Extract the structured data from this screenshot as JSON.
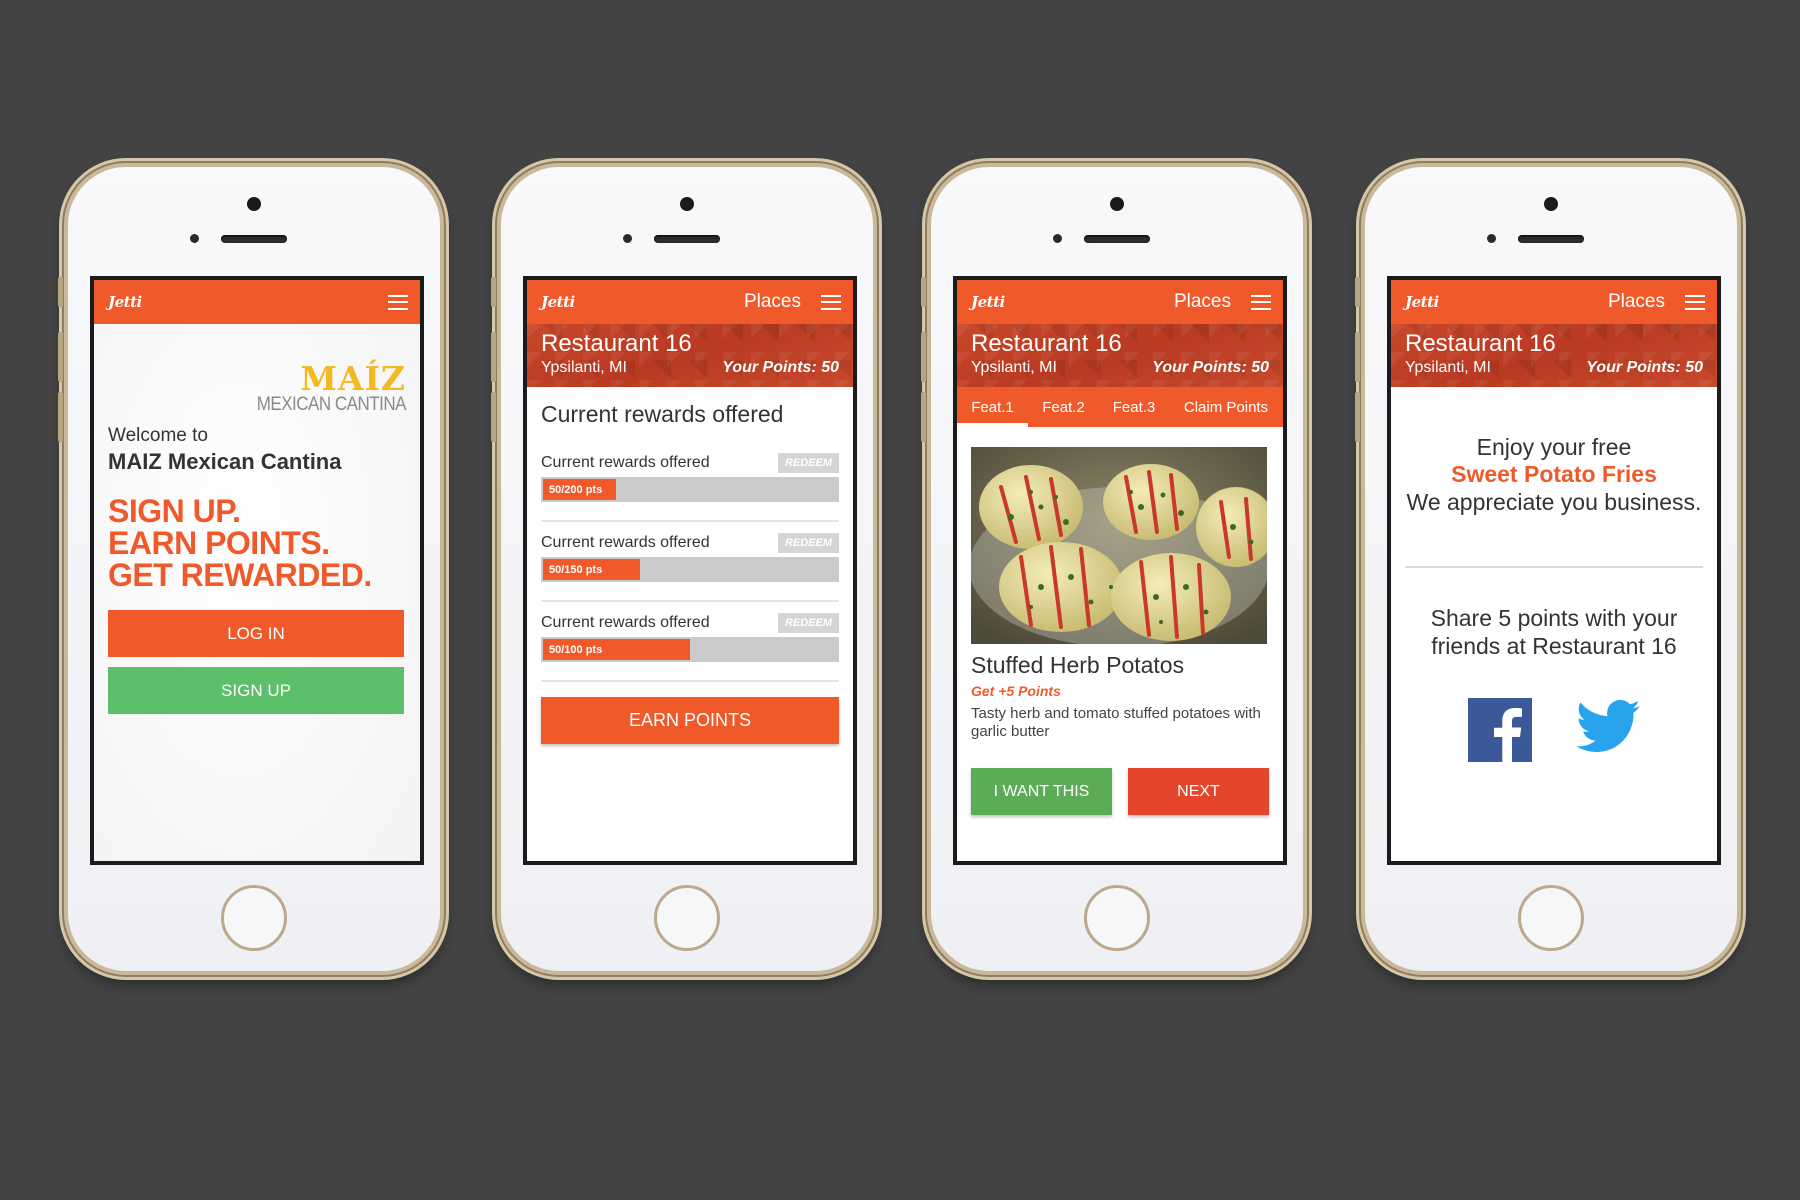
{
  "brand": {
    "logo": "Jetti",
    "accent": "#f05a2b",
    "green": "#5cbf6a",
    "background": "#434343"
  },
  "screen1": {
    "restaurant_logo_main": "MAÍZ",
    "restaurant_logo_sub": "MEXICAN CANTINA",
    "welcome_line": "Welcome to",
    "welcome_name": "MAIZ Mexican Cantina",
    "slogan": [
      "SIGN UP.",
      "EARN POINTS.",
      "GET REWARDED."
    ],
    "login_label": "LOG IN",
    "signup_label": "SIGN UP"
  },
  "nav": {
    "places_label": "Places",
    "menu_icon": "hamburger-icon"
  },
  "restaurant": {
    "name": "Restaurant 16",
    "location": "Ypsilanti, MI",
    "points_label": "Your Points: 50"
  },
  "screen2": {
    "title": "Current rewards offered",
    "rewards": [
      {
        "label": "Current rewards offered",
        "redeem": "REDEEM",
        "progress_text": "50/200 pts",
        "fraction": 0.25
      },
      {
        "label": "Current rewards offered",
        "redeem": "REDEEM",
        "progress_text": "50/150 pts",
        "fraction": 0.333
      },
      {
        "label": "Current rewards offered",
        "redeem": "REDEEM",
        "progress_text": "50/100 pts",
        "fraction": 0.5
      }
    ],
    "earn_label": "EARN POINTS"
  },
  "screen3": {
    "tabs": [
      "Feat.1",
      "Feat.2",
      "Feat.3",
      "Claim Points"
    ],
    "active_tab": 0,
    "dish_title": "Stuffed Herb Potatos",
    "dish_points": "Get +5 Points",
    "dish_desc": "Tasty herb and tomato stuffed potatoes with garlic butter",
    "want_label": "I WANT THIS",
    "next_label": "NEXT"
  },
  "screen4": {
    "enjoy_line": "Enjoy your free",
    "free_item": "Sweet Potato Fries",
    "thanks_line": "We appreciate you business.",
    "share_line1": "Share 5 points with your",
    "share_line2": "friends at Restaurant 16",
    "social_icons": [
      "facebook-icon",
      "twitter-icon"
    ]
  }
}
